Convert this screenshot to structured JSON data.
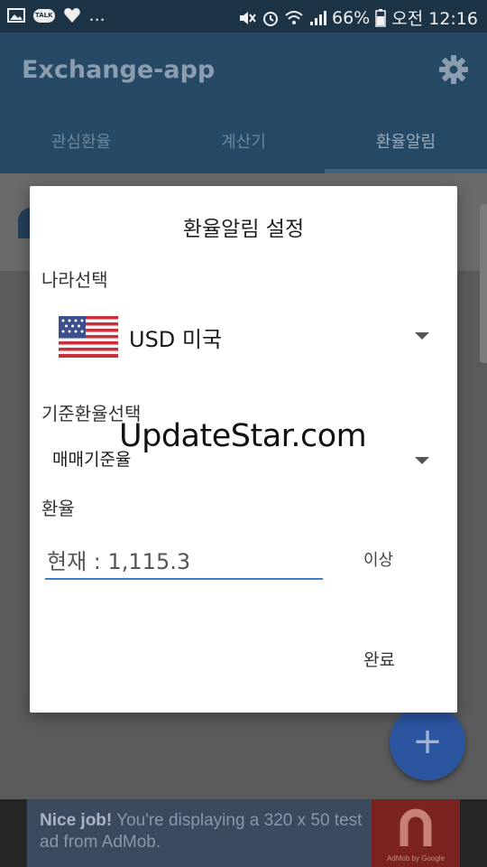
{
  "status_bar": {
    "left_icons": [
      "image-icon",
      "kakaotalk-icon",
      "heart-icon"
    ],
    "talk_badge": "TALK",
    "more": "...",
    "battery": "66%",
    "time": "오전 12:16",
    "right_icons": [
      "mute-icon",
      "alarm-icon",
      "wifi-icon",
      "signal-icon",
      "battery-icon"
    ]
  },
  "appbar": {
    "title": "Exchange-app",
    "settings_icon": "gear-icon",
    "tabs": [
      {
        "label": "관심환율"
      },
      {
        "label": "계산기"
      },
      {
        "label": "환율알림"
      }
    ],
    "active_tab": 2
  },
  "dialog": {
    "title": "환율알림 설정",
    "country_label": "나라선택",
    "country_value": "USD 미국",
    "country_flag": "us-flag",
    "rate_base_label": "기준환율선택",
    "rate_base_value": "매매기준율",
    "rate_label": "환율",
    "rate_input_value": "현재 : 1,115.3",
    "above_button": "이상",
    "done_button": "완료"
  },
  "watermark": "UpdateStar.com",
  "fab": {
    "label": "+",
    "icon": "plus-icon"
  },
  "ad": {
    "bold": "Nice job!",
    "text": " You're displaying a 320 x 50 test ad from AdMob.",
    "logo_label": "AdMob by Google",
    "logo_icon": "admob-icon"
  },
  "colors": {
    "appbar": "#264a66",
    "status_bar": "#1d3447",
    "accent_underline": "#3f7cc9",
    "fab": "#2c55a0",
    "ad_background": "#3c4a60",
    "ad_logo": "#7a2320"
  }
}
